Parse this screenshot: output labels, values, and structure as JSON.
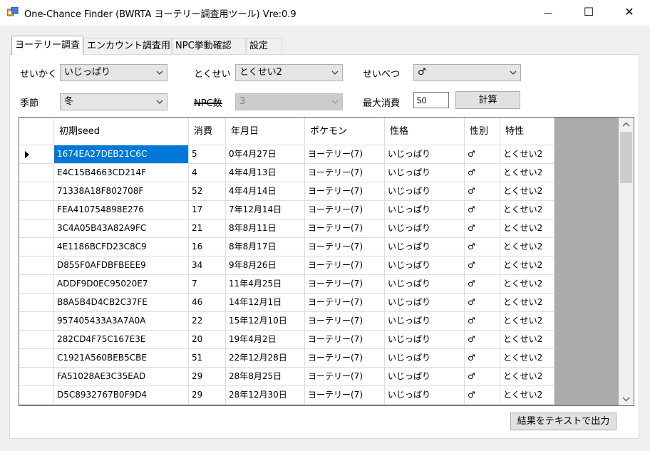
{
  "window": {
    "title": "One-Chance Finder (BWRTA ヨーテリー調査用ツール) Vre:0.9",
    "minimize_glyph": "—",
    "maximize_glyph": "☐",
    "close_glyph": "✕"
  },
  "tabs": [
    {
      "label": "ヨーテリー調査",
      "active": true
    },
    {
      "label": "エンカウント調査用"
    },
    {
      "label": "NPC挙動確認"
    },
    {
      "label": "設定"
    }
  ],
  "form": {
    "seikaku_label": "せいかく",
    "seikaku_value": "いじっぱり",
    "tokusei_label": "とくせい",
    "tokusei_value": "とくせい2",
    "seibetsu_label": "せいべつ",
    "seibetsu_value": "♂",
    "season_label": "季節",
    "season_value": "冬",
    "npc_label": "NPC数",
    "npc_value": "3",
    "max_cost_label": "最大消費",
    "max_cost_value": "50",
    "calc_button": "計算"
  },
  "grid": {
    "columns": [
      "初期seed",
      "消費",
      "年月日",
      "ポケモン",
      "性格",
      "性別",
      "特性"
    ],
    "rows": [
      [
        "1674EA27DEB21C6C",
        "5",
        "0年4月27日",
        "ヨーテリー(7)",
        "いじっぱり",
        "♂",
        "とくせい2"
      ],
      [
        "E4C15B4663CD214F",
        "4",
        "4年4月13日",
        "ヨーテリー(7)",
        "いじっぱり",
        "♂",
        "とくせい2"
      ],
      [
        "71338A18F802708F",
        "52",
        "4年4月14日",
        "ヨーテリー(7)",
        "いじっぱり",
        "♂",
        "とくせい2"
      ],
      [
        "FEA410754898E276",
        "17",
        "7年12月14日",
        "ヨーテリー(7)",
        "いじっぱり",
        "♂",
        "とくせい2"
      ],
      [
        "3C4A05B43A82A9FC",
        "21",
        "8年8月11日",
        "ヨーテリー(7)",
        "いじっぱり",
        "♂",
        "とくせい2"
      ],
      [
        "4E1186BCFD23C8C9",
        "16",
        "8年8月17日",
        "ヨーテリー(7)",
        "いじっぱり",
        "♂",
        "とくせい2"
      ],
      [
        "D855F0AFDBFBEEE9",
        "34",
        "9年8月26日",
        "ヨーテリー(7)",
        "いじっぱり",
        "♂",
        "とくせい2"
      ],
      [
        "ADDF9D0EC95020E7",
        "7",
        "11年4月25日",
        "ヨーテリー(7)",
        "いじっぱり",
        "♂",
        "とくせい2"
      ],
      [
        "B8A5B4D4CB2C37FE",
        "46",
        "14年12月1日",
        "ヨーテリー(7)",
        "いじっぱり",
        "♂",
        "とくせい2"
      ],
      [
        "957405433A3A7A0A",
        "22",
        "15年12月10日",
        "ヨーテリー(7)",
        "いじっぱり",
        "♂",
        "とくせい2"
      ],
      [
        "282CD4F75C167E3E",
        "20",
        "19年4月2日",
        "ヨーテリー(7)",
        "いじっぱり",
        "♂",
        "とくせい2"
      ],
      [
        "C1921A560BEB5CBE",
        "51",
        "22年12月28日",
        "ヨーテリー(7)",
        "いじっぱり",
        "♂",
        "とくせい2"
      ],
      [
        "FA51028AE3C35EAD",
        "29",
        "28年8月25日",
        "ヨーテリー(7)",
        "いじっぱり",
        "♂",
        "とくせい2"
      ],
      [
        "D5C8932767B0F9D4",
        "29",
        "28年12月30日",
        "ヨーテリー(7)",
        "いじっぱり",
        "♂",
        "とくせい2"
      ]
    ]
  },
  "export_button": "結果をテキストで出力",
  "colors": {
    "selection": "#0078d7",
    "grid_background": "#ababab",
    "window_background": "#f0f0f0"
  }
}
